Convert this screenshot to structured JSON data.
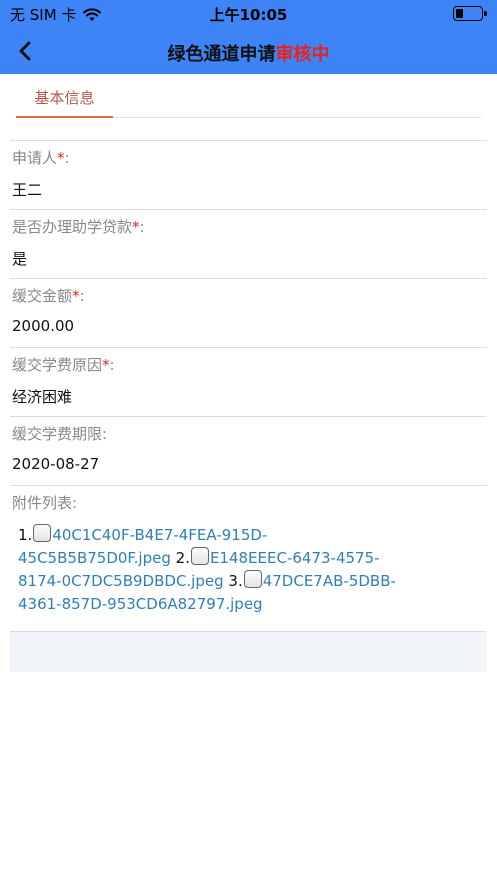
{
  "status_bar": {
    "carrier": "无 SIM 卡",
    "time": "上午10:05"
  },
  "nav": {
    "title": "绿色通道申请",
    "status": "审核中"
  },
  "tabs": [
    {
      "label": "基本信息"
    }
  ],
  "fields": [
    {
      "label": "申请人",
      "required": true,
      "value": "王二"
    },
    {
      "label": "是否办理助学贷款",
      "required": true,
      "value": "是"
    },
    {
      "label": "缓交金额",
      "required": true,
      "value": "2000.00"
    },
    {
      "label": "缓交学费原因",
      "required": true,
      "value": "经济困难"
    },
    {
      "label": "缓交学费期限",
      "required": false,
      "value": "2020-08-27"
    }
  ],
  "attachments": {
    "label": "附件列表",
    "items": [
      {
        "index": "1.",
        "name": "40C1C40F-B4E7-4FEA-915D-45C5B5B75D0F.jpeg"
      },
      {
        "index": "2.",
        "name": "E148EEEC-6473-4575-8174-0C7DC5B9DBDC.jpeg"
      },
      {
        "index": "3.",
        "name": "47DCE7AB-5DBB-4361-857D-953CD6A82797.jpeg"
      }
    ]
  },
  "colors": {
    "header": "#3e84f6",
    "status_text": "#e8231b",
    "tab_text": "#b3584a",
    "link": "#2f7fb8"
  }
}
